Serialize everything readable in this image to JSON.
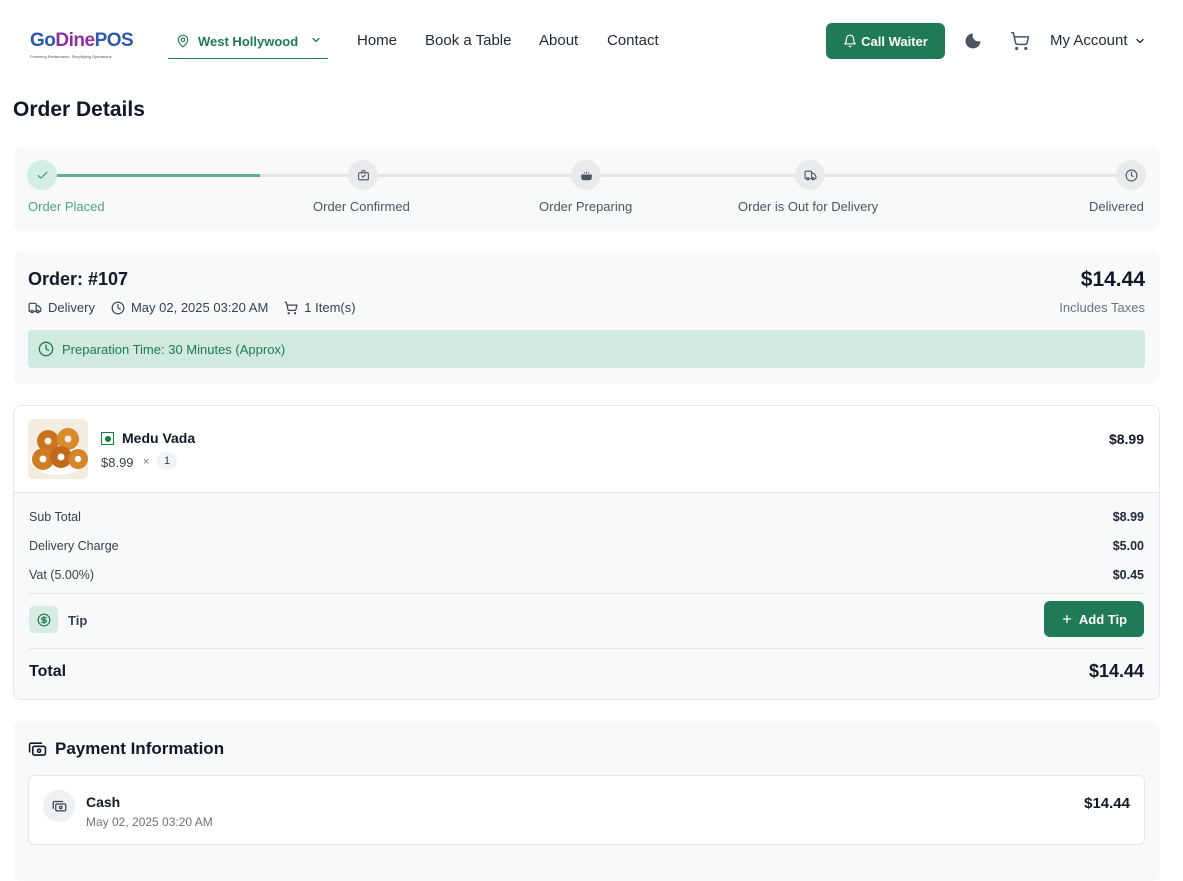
{
  "brand": {
    "logo_part1": "Go",
    "logo_part2": "Dine",
    "logo_part3": "POS",
    "tagline": "Powering Restaurants, Simplifying Operations"
  },
  "header": {
    "location": "West Hollywood",
    "nav": [
      "Home",
      "Book a Table",
      "About",
      "Contact"
    ],
    "call_waiter": "Call Waiter",
    "account": "My Account"
  },
  "page": {
    "title": "Order Details"
  },
  "progress": {
    "steps": [
      {
        "label": "Order Placed",
        "icon": "check-icon",
        "done": true
      },
      {
        "label": "Order Confirmed",
        "icon": "briefcase-check-icon",
        "done": false
      },
      {
        "label": "Order Preparing",
        "icon": "cooking-pot-icon",
        "done": false
      },
      {
        "label": "Order is Out for Delivery",
        "icon": "truck-icon",
        "done": false
      },
      {
        "label": "Delivered",
        "icon": "clock-icon",
        "done": false
      }
    ],
    "completed_fraction": 0.2
  },
  "order": {
    "number": "Order: #107",
    "type": "Delivery",
    "datetime": "May 02, 2025 03:20 AM",
    "items_count": "1 Item(s)",
    "total": "$14.44",
    "tax_note": "Includes Taxes",
    "prep_time": "Preparation Time: 30 Minutes (Approx)"
  },
  "items": [
    {
      "name": "Medu Vada",
      "price": "$8.99",
      "times": "×",
      "qty": "1",
      "line_total": "$8.99",
      "veg": true
    }
  ],
  "bill": {
    "subtotal_label": "Sub Total",
    "subtotal": "$8.99",
    "delivery_label": "Delivery Charge",
    "delivery": "$5.00",
    "vat_label": "Vat (5.00%)",
    "vat": "$0.45",
    "tip_label": "Tip",
    "add_tip": "Add Tip",
    "total_label": "Total",
    "total": "$14.44"
  },
  "payment": {
    "heading": "Payment Information",
    "method": "Cash",
    "date": "May 02, 2025 03:20 AM",
    "amount": "$14.44"
  },
  "colors": {
    "accent": "#1f7a55",
    "accent_light": "#d1eadf",
    "step_done": "#4fa582"
  }
}
